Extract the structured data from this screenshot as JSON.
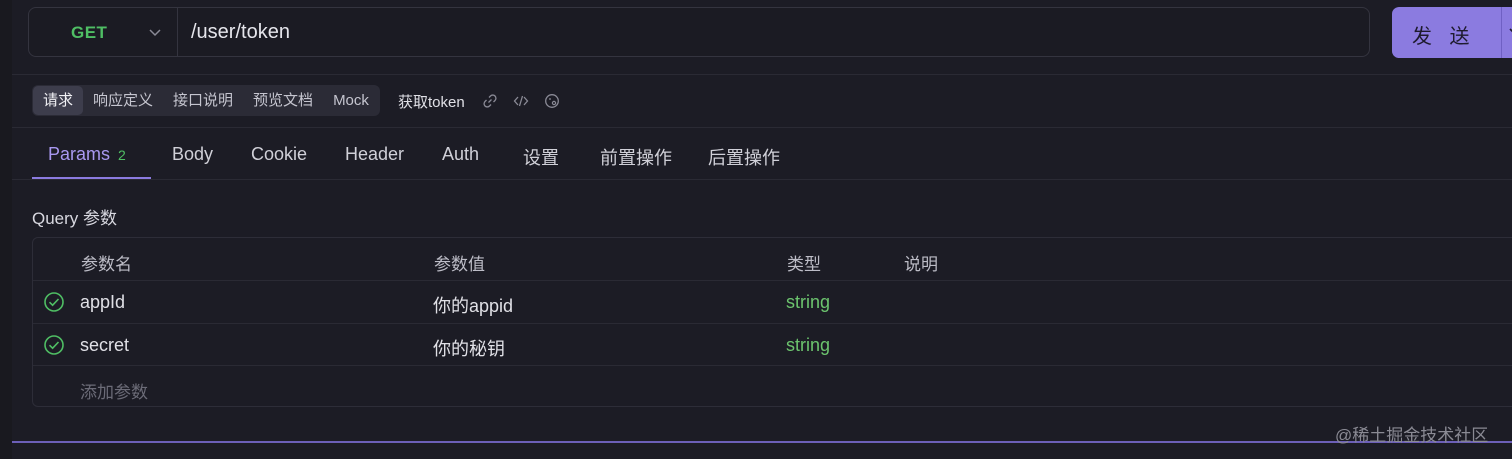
{
  "request": {
    "method": "GET",
    "url": "/user/token",
    "send_label": "发 送"
  },
  "subtabs": [
    {
      "label": "请求",
      "active": true
    },
    {
      "label": "响应定义",
      "active": false
    },
    {
      "label": "接口说明",
      "active": false
    },
    {
      "label": "预览文档",
      "active": false
    },
    {
      "label": "Mock",
      "active": false
    }
  ],
  "api_name": "获取token",
  "toolbar_icons": [
    "link-icon",
    "code-icon",
    "palette-icon"
  ],
  "tabs": [
    {
      "label": "Params",
      "badge": "2",
      "active": true
    },
    {
      "label": "Body"
    },
    {
      "label": "Cookie"
    },
    {
      "label": "Header"
    },
    {
      "label": "Auth"
    },
    {
      "label": "设置"
    },
    {
      "label": "前置操作"
    },
    {
      "label": "后置操作"
    }
  ],
  "query": {
    "title": "Query 参数",
    "columns": [
      "参数名",
      "参数值",
      "类型",
      "说明"
    ],
    "rows": [
      {
        "enabled": true,
        "name": "appId",
        "value": "你的appid",
        "type": "string",
        "desc": ""
      },
      {
        "enabled": true,
        "name": "secret",
        "value": "你的秘钥",
        "type": "string",
        "desc": ""
      }
    ],
    "add_placeholder": "添加参数"
  },
  "watermark": "@稀土掘金技术社区",
  "colors": {
    "accent": "#8b7be0",
    "method_get": "#4fbe64",
    "type_string": "#6cc46e",
    "background": "#1c1c25"
  }
}
